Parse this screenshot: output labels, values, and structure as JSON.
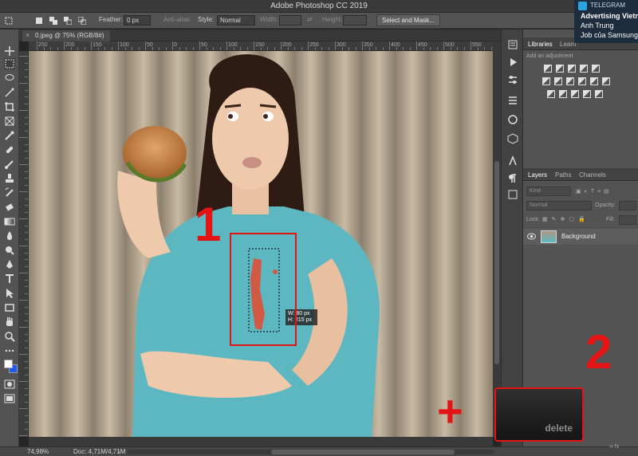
{
  "app": {
    "title": "Adobe Photoshop CC 2019"
  },
  "options": {
    "feather_label": "Feather:",
    "feather_value": "0 px",
    "antialias_label": "Anti-alias",
    "style_label": "Style:",
    "style_value": "Normal",
    "width_label": "Width:",
    "height_label": "Height:",
    "select_mask_button": "Select and Mask..."
  },
  "document": {
    "tab_label": "0.jpeg @ 75% (RGB/8#)",
    "close_glyph": "×"
  },
  "ruler": {
    "labels": [
      "250",
      "200",
      "150",
      "100",
      "50",
      "0",
      "50",
      "100",
      "150",
      "200",
      "250",
      "300",
      "350",
      "400",
      "450",
      "500",
      "550"
    ]
  },
  "canvas": {
    "selection_size": {
      "w": "W: 80 px",
      "h": "H: 215 px"
    }
  },
  "status": {
    "zoom": "74,98%",
    "doc": "Doc: 4,71M/4,71M",
    "arrow": "›"
  },
  "panels": {
    "top_tabs": [
      {
        "label": "Libraries"
      },
      {
        "label": "Learn"
      }
    ],
    "adjustment_hint": "Add an adjustment",
    "layer_tabs": [
      {
        "label": "Layers"
      },
      {
        "label": "Paths"
      },
      {
        "label": "Channels"
      }
    ],
    "kind_placeholder": "Kind",
    "blend_mode": "Normal",
    "opacity_label": "Opacity:",
    "lock_label": "Lock:",
    "fill_label": "Fill:",
    "layer_name": "Background",
    "footer_icons": "∞  fx"
  },
  "notification": {
    "app": "TELEGRAM",
    "lines": [
      "Advertising Vietna",
      "Anh Trung",
      "Job của Samsung"
    ]
  },
  "annotations": {
    "step1": "1",
    "step2": "2",
    "plus": "+",
    "delete_key": "delete"
  },
  "colors": {
    "accent_red": "#e41414",
    "panel": "#535353",
    "dark": "#262626"
  }
}
